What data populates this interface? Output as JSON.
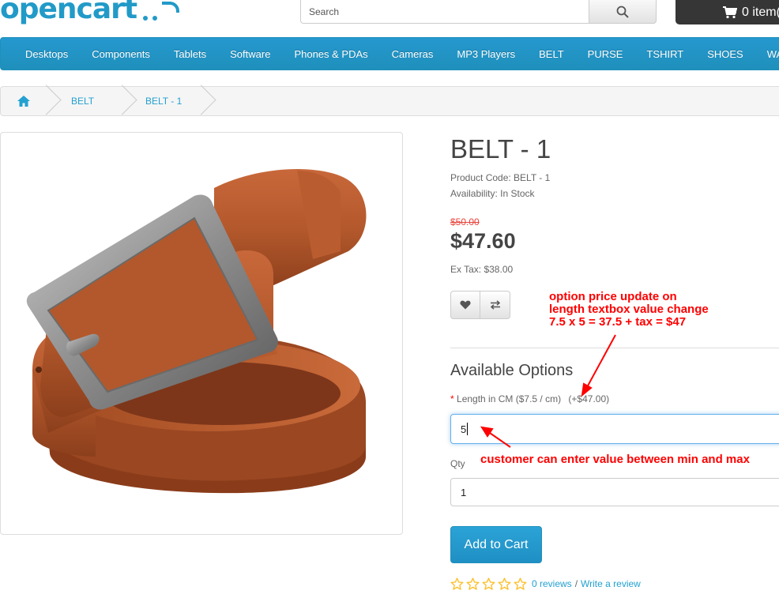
{
  "header": {
    "logo_text": "opencart",
    "search": {
      "placeholder": "Search",
      "value": ""
    },
    "cart_label": "0 item("
  },
  "menu": {
    "items": [
      "Desktops",
      "Components",
      "Tablets",
      "Software",
      "Phones & PDAs",
      "Cameras",
      "MP3 Players",
      "BELT",
      "PURSE",
      "TSHIRT",
      "SHOES",
      "WALLET"
    ]
  },
  "breadcrumb": {
    "items": [
      "BELT",
      "BELT - 1"
    ]
  },
  "product": {
    "title": "BELT - 1",
    "product_code": "Product Code: BELT - 1",
    "availability": "Availability: In Stock",
    "old_price": "$50.00",
    "price": "$47.60",
    "ex_tax": "Ex Tax: $38.00"
  },
  "options": {
    "heading": "Available Options",
    "length_label": "Length in CM ($7.5 / cm)",
    "length_price_modifier": "(+$47.00)",
    "length_value": "5",
    "qty_label": "Qty",
    "qty_value": "1",
    "add_to_cart": "Add to Cart"
  },
  "reviews": {
    "rating": 0,
    "max_rating": 5,
    "reviews_link": "0 reviews",
    "separator": "/",
    "write_review": "Write a review"
  },
  "annotations": {
    "top_lines": [
      "option price update on",
      "length textbox value change",
      "7.5 x 5 = 37.5 + tax = $47"
    ],
    "bottom": "customer can enter value between min and max",
    "color": "#ff0000"
  },
  "colors": {
    "brand": "#229ac8",
    "menu": "#229ac8",
    "link": "#23a1d1",
    "old_price": "#e9433b",
    "star": "#fcc02d"
  },
  "icons": {
    "search": "search-icon",
    "cart": "shopping-cart-icon",
    "home": "home-icon",
    "wishlist": "heart-icon",
    "compare": "exchange-icon",
    "star": "star-outline-icon"
  }
}
